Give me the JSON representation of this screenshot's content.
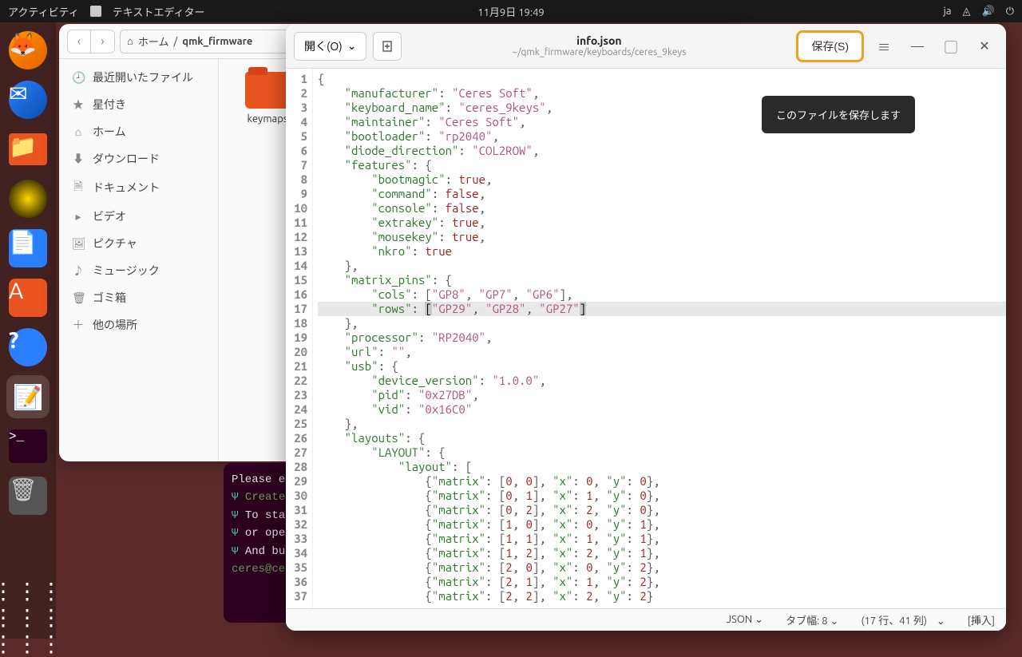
{
  "topbar": {
    "activities": "アクティビティ",
    "app_name": "テキストエディター",
    "datetime": "11月9日  19:49",
    "lang": "ja"
  },
  "filemgr": {
    "breadcrumb_home": "ホーム",
    "breadcrumb_path": "qmk_firmware",
    "sidebar": [
      "最近開いたファイル",
      "星付き",
      "ホーム",
      "ダウンロード",
      "ドキュメント",
      "ビデオ",
      "ピクチャ",
      "ミュージック",
      "ゴミ箱",
      "他の場所"
    ],
    "folder": "keymaps"
  },
  "terminal": {
    "l1": "Please e",
    "l2": "Create",
    "l3": "To sta",
    "l4": "or ope",
    "l5": "And bu",
    "l6": "ceres@ce"
  },
  "editor": {
    "open_label": "開く(O)",
    "title": "info.json",
    "subtitle": "~/qmk_firmware/keyboards/ceres_9keys",
    "save_label": "保存(S)",
    "tooltip": "このファイルを保存します",
    "status_lang": "JSON",
    "status_tab": "タブ幅: 8",
    "status_pos": "(17 行、41 列)",
    "status_mode": "[挿入]"
  },
  "code": {
    "lines": [
      "{",
      "    \"manufacturer\": \"Ceres Soft\",",
      "    \"keyboard_name\": \"ceres_9keys\",",
      "    \"maintainer\": \"Ceres Soft\",",
      "    \"bootloader\": \"rp2040\",",
      "    \"diode_direction\": \"COL2ROW\",",
      "    \"features\": {",
      "        \"bootmagic\": true,",
      "        \"command\": false,",
      "        \"console\": false,",
      "        \"extrakey\": true,",
      "        \"mousekey\": true,",
      "        \"nkro\": true",
      "    },",
      "    \"matrix_pins\": {",
      "        \"cols\": [\"GP8\", \"GP7\", \"GP6\"],",
      "        \"rows\": [\"GP29\", \"GP28\", \"GP27\"]",
      "    },",
      "    \"processor\": \"RP2040\",",
      "    \"url\": \"\",",
      "    \"usb\": {",
      "        \"device_version\": \"1.0.0\",",
      "        \"pid\": \"0x27DB\",",
      "        \"vid\": \"0x16C0\"",
      "    },",
      "    \"layouts\": {",
      "        \"LAYOUT\": {",
      "            \"layout\": [",
      "                {\"matrix\": [0, 0], \"x\": 0, \"y\": 0},",
      "                {\"matrix\": [0, 1], \"x\": 1, \"y\": 0},",
      "                {\"matrix\": [0, 2], \"x\": 2, \"y\": 0},",
      "                {\"matrix\": [1, 0], \"x\": 0, \"y\": 1},",
      "                {\"matrix\": [1, 1], \"x\": 1, \"y\": 1},",
      "                {\"matrix\": [1, 2], \"x\": 2, \"y\": 1},",
      "                {\"matrix\": [2, 0], \"x\": 0, \"y\": 2},",
      "                {\"matrix\": [2, 1], \"x\": 1, \"y\": 2},",
      "                {\"matrix\": [2, 2], \"x\": 2, \"y\": 2}"
    ],
    "highlight_line": 17
  }
}
